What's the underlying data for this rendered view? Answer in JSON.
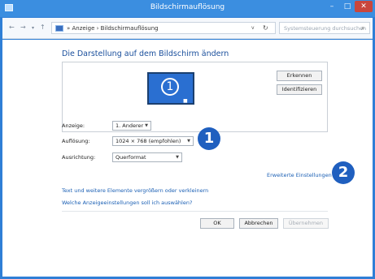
{
  "window": {
    "title": "Bildschirmauflösung",
    "controls": {
      "minimize": "–",
      "maximize": "□",
      "close": "✕"
    },
    "accent_color": "#3b8ee0"
  },
  "addressbar": {
    "back": "←",
    "forward": "→",
    "dropdown": "▾",
    "up": "↑",
    "path": "» Anzeige › Bildschirmauflösung",
    "path_dropdown": "v",
    "refresh": "↻",
    "search_placeholder": "Systemsteuerung durchsuchen",
    "search_icon": "search-icon"
  },
  "main": {
    "heading": "Die Darstellung auf dem Bildschirm ändern",
    "preview": {
      "monitor_number": "1",
      "monitor_dots": "■ ■ ■",
      "detect_button": "Erkennen",
      "identify_button": "Identifizieren"
    },
    "form": {
      "display_label": "Anzeige:",
      "display_value": "1. Anderer",
      "resolution_label": "Auflösung:",
      "resolution_value": "1024 × 768 (empfohlen)",
      "orientation_label": "Ausrichtung:",
      "orientation_value": "Querformat",
      "dropdown_arrow": "▼"
    },
    "callouts": {
      "one": "1",
      "two": "2"
    },
    "links": {
      "advanced": "Erweiterte Einstellungen",
      "text_size": "Text und weitere Elemente vergrößern oder verkleinern",
      "which_settings": "Welche Anzeigeeinstellungen soll ich auswählen?"
    },
    "buttons": {
      "ok": "OK",
      "cancel": "Abbrechen",
      "apply": "Übernehmen"
    }
  }
}
